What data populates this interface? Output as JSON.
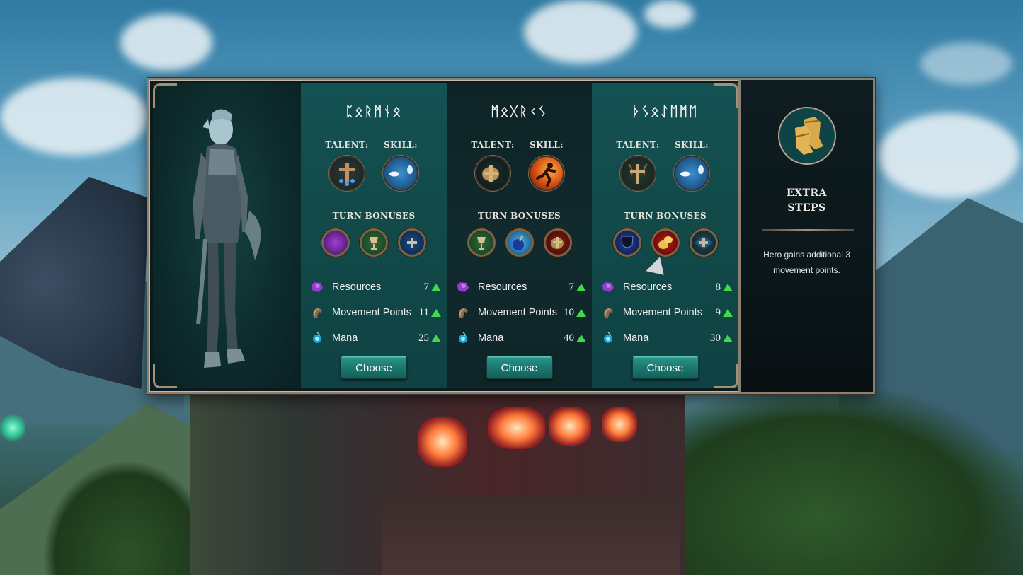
{
  "heroes": [
    {
      "name": "ᛈᛟᚱᛗᚾᛟ",
      "talent_label": "TALENT:",
      "skill_label": "SKILL:",
      "talent_icon": "holy-cross-drops-icon",
      "skill_icon": "blue-scarab-icon",
      "turn_bonuses_label": "TURN BONUSES",
      "turn_bonuses": [
        "purple-scarab-icon",
        "golden-chalice-wreath-icon",
        "blue-potion-cross-icon"
      ],
      "stats": [
        {
          "label": "Resources",
          "value": "7",
          "icon": "purple-gem-icon",
          "trend": "up"
        },
        {
          "label": "Movement Points",
          "value": "11",
          "icon": "horse-head-icon",
          "trend": "up"
        },
        {
          "label": "Mana",
          "value": "25",
          "icon": "mana-orb-icon",
          "trend": "up"
        }
      ],
      "choose_label": "Choose"
    },
    {
      "name": "ᛗᛟᚷᚱᚲᛊ",
      "talent_label": "TALENT:",
      "skill_label": "SKILL:",
      "talent_icon": "golden-boots-cross-icon",
      "skill_icon": "flaming-runner-icon",
      "turn_bonuses_label": "TURN BONUSES",
      "turn_bonuses": [
        "golden-chalice-wreath-icon",
        "blue-potion-icon",
        "golden-boots-red-icon"
      ],
      "stats": [
        {
          "label": "Resources",
          "value": "7",
          "icon": "purple-gem-icon",
          "trend": "up"
        },
        {
          "label": "Movement Points",
          "value": "10",
          "icon": "horse-head-icon",
          "trend": "up"
        },
        {
          "label": "Mana",
          "value": "40",
          "icon": "mana-orb-icon",
          "trend": "up"
        }
      ],
      "choose_label": "Choose"
    },
    {
      "name": "ᚦᛊᛟᛇᛖᛗᛖ",
      "talent_label": "TALENT:",
      "skill_label": "SKILL:",
      "talent_icon": "horned-warrior-cross-icon",
      "skill_icon": "blue-scarab-icon",
      "turn_bonuses_label": "TURN BONUSES",
      "turn_bonuses": [
        "dark-shield-icon",
        "golden-boots-red-icon",
        "blue-diamond-cross-icon"
      ],
      "stats": [
        {
          "label": "Resources",
          "value": "8",
          "icon": "purple-gem-icon",
          "trend": "up"
        },
        {
          "label": "Movement Points",
          "value": "9",
          "icon": "horse-head-icon",
          "trend": "up"
        },
        {
          "label": "Mana",
          "value": "30",
          "icon": "mana-orb-icon",
          "trend": "up"
        }
      ],
      "choose_label": "Choose"
    }
  ],
  "detail": {
    "icon": "golden-boots-icon",
    "title": "EXTRA STEPS",
    "description": "Hero gains additional 3 movement points."
  },
  "colors": {
    "teal_column": "#155253",
    "dark_column": "#0d2326",
    "button": "#1c7770",
    "arrow_up": "#3fd94a",
    "frame": "#8b7f72"
  }
}
